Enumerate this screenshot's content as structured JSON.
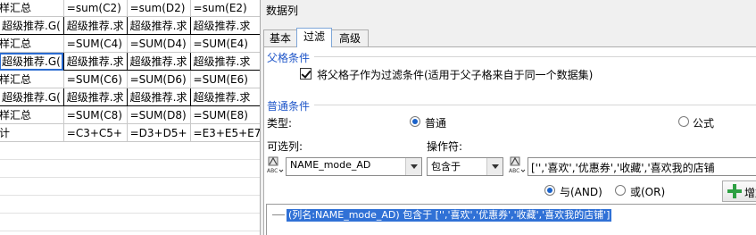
{
  "sheet": {
    "rows": [
      [
        "样汇总",
        "=sum(C2)",
        "=sum(D2)",
        "=sum(E2)"
      ],
      [
        "超级推荐.G(",
        "超级推荐.求",
        "超级推荐.求",
        "超级推荐.求"
      ],
      [
        "样汇总",
        "=SUM(C4)",
        "=SUM(D4)",
        "=SUM(E4)"
      ],
      [
        "超级推荐.G(",
        "超级推荐.求",
        "超级推荐.求",
        "超级推荐.求"
      ],
      [
        "样汇总",
        "=SUM(C6)",
        "=SUM(D6)",
        "=SUM(E6)"
      ],
      [
        "超级推荐.G(",
        "超级推荐.求",
        "超级推荐.求",
        "超级推荐.求"
      ],
      [
        "样汇总",
        "=SUM(C8)",
        "=SUM(D8)",
        "=SUM(E8)"
      ],
      [
        "计",
        "=C3+C5+",
        "=D3+D5+",
        "=E3+E5+E7"
      ]
    ]
  },
  "panel": {
    "title": "数据列",
    "tabs": [
      "基本",
      "过滤",
      "高级"
    ],
    "parent_group": {
      "label": "父格条件",
      "checkbox_label": "将父格子作为过滤条件(适用于父子格来自于同一个数据集)",
      "checked": true
    },
    "normal_group": {
      "label": "普通条件",
      "type_label": "类型:",
      "type_normal": "普通",
      "type_formula": "公式",
      "selectable_col_label": "可选列:",
      "operator_label": "操作符:",
      "column_value": "NAME_mode_AD",
      "operator_value": "包含于",
      "value_text": "['','喜欢','优惠券','收藏','喜欢我的店铺",
      "and_label": "与(AND)",
      "or_label": "或(OR)",
      "add_label": "增加"
    },
    "result": "(列名:NAME_mode_AD) 包含于 ['','喜欢','优惠券','收藏','喜欢我的店铺']"
  },
  "colors": {
    "accent": "#1e55c8",
    "selection": "#3071d6",
    "add_icon": "#2ea043"
  },
  "icons": [
    "abc-column-icon",
    "abc-value-icon",
    "plus-icon",
    "checkbox-checked-icon"
  ]
}
